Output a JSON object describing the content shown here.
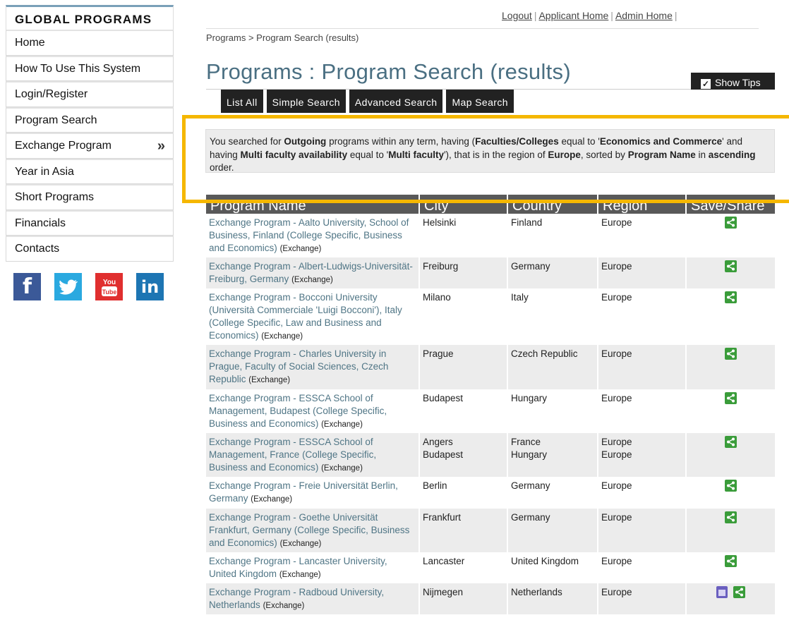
{
  "sidebar": {
    "header": "GLOBAL PROGRAMS",
    "items": [
      {
        "label": "Home"
      },
      {
        "label": "How To Use This System"
      },
      {
        "label": "Login/Register"
      },
      {
        "label": "Program Search"
      },
      {
        "label": "Exchange Program",
        "chevron": "»"
      },
      {
        "label": "Year in Asia"
      },
      {
        "label": "Short Programs"
      },
      {
        "label": "Financials"
      },
      {
        "label": "Contacts"
      }
    ],
    "social": [
      "facebook-icon",
      "twitter-icon",
      "youtube-icon",
      "linkedin-icon"
    ]
  },
  "toplinks": {
    "logout": "Logout",
    "applicant_home": "Applicant Home",
    "admin_home": "Admin Home"
  },
  "breadcrumb": "Programs > Program Search (results)",
  "title": "Programs : Program Search (results)",
  "show_tips": "Show Tips",
  "tabs": [
    "List All",
    "Simple Search",
    "Advanced Search",
    "Map Search"
  ],
  "summary": {
    "t1": "You searched for ",
    "b1": "Outgoing",
    "t2": " programs within any term, having (",
    "b2": "Faculties/Colleges",
    "t3": " equal to '",
    "b3": "Economics and Commerce",
    "t4": "' and having ",
    "b4": "Multi faculty availability",
    "t5": " equal to '",
    "b5": "Multi faculty",
    "t6": "'), that is in the region of ",
    "b6": "Europe",
    "t7": ", sorted by ",
    "b7": "Program Name",
    "t8": " in ",
    "b8": "ascending",
    "t9": " order."
  },
  "table": {
    "headers": [
      "Program Name",
      "City",
      "Country",
      "Region",
      "Save/Share"
    ],
    "rows": [
      {
        "name": "Exchange Program - Aalto University, School of Business, Finland (College Specific, Business and Economics)",
        "type": "(Exchange)",
        "city": "Helsinki",
        "country": "Finland",
        "region": "Europe"
      },
      {
        "name": "Exchange Program - Albert-Ludwigs-Universität-Freiburg, Germany",
        "type": "(Exchange)",
        "city": "Freiburg",
        "country": "Germany",
        "region": "Europe"
      },
      {
        "name": "Exchange Program - Bocconi University (Università Commerciale 'Luigi Bocconi'), Italy (College Specific, Law and Business and Economics)",
        "type": "(Exchange)",
        "city": "Milano",
        "country": "Italy",
        "region": "Europe"
      },
      {
        "name": "Exchange Program - Charles University in Prague, Faculty of Social Sciences, Czech Republic",
        "type": "(Exchange)",
        "city": "Prague",
        "country": "Czech Republic",
        "region": "Europe"
      },
      {
        "name": "Exchange Program - ESSCA School of Management, Budapest (College Specific, Business and Economics)",
        "type": "(Exchange)",
        "city": "Budapest",
        "country": "Hungary",
        "region": "Europe"
      },
      {
        "name": "Exchange Program - ESSCA School of Management, France (College Specific, Business and Economics)",
        "type": "(Exchange)",
        "city": "Angers\nBudapest",
        "country": "France\nHungary",
        "region": "Europe\nEurope"
      },
      {
        "name": "Exchange Program - Freie Universität Berlin, Germany",
        "type": "(Exchange)",
        "city": "Berlin",
        "country": "Germany",
        "region": "Europe"
      },
      {
        "name": "Exchange Program - Goethe Universität Frankfurt, Germany (College Specific, Business and Economics)",
        "type": "(Exchange)",
        "city": "Frankfurt",
        "country": "Germany",
        "region": "Europe"
      },
      {
        "name": "Exchange Program - Lancaster University, United Kingdom",
        "type": "(Exchange)",
        "city": "Lancaster",
        "country": "United Kingdom",
        "region": "Europe"
      },
      {
        "name": "Exchange Program - Radboud University, Netherlands",
        "type": "(Exchange)",
        "city": "Nijmegen",
        "country": "Netherlands",
        "region": "Europe",
        "calendar": true
      }
    ]
  }
}
